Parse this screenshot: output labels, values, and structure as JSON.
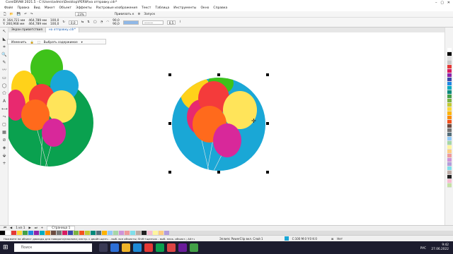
{
  "window": {
    "title": "CorelDRAW 2021.5 - C:\\Users\\admin\\Desktop\\PERW\\на отправку.cdr*"
  },
  "menu": [
    "Файл",
    "Правка",
    "Вид",
    "Макет",
    "Объект",
    "Эффекты",
    "Растровые изображения",
    "Текст",
    "Таблица",
    "Инструменты",
    "Окно",
    "Справка"
  ],
  "toolbar": {
    "zoom": "23%",
    "snap_label": "Привязать к",
    "launch_label": "Запуск"
  },
  "propertybar": {
    "x": "X: 164,721 мм",
    "y": "Y: 260,968 мм",
    "w": "464,789 мм",
    "h": "464,789 мм",
    "sx": "100,0",
    "sy": "100,0",
    "angle": "0,0",
    "outline": "0,5",
    "val1": "90,0",
    "val2": "90,0"
  },
  "tabs": [
    {
      "label": "Экран приветствия",
      "active": false
    },
    {
      "label": "на отправку.cdr*",
      "active": true
    }
  ],
  "floatbar": {
    "edit_label": "Изменить",
    "select_label": "Выбрать содержимое"
  },
  "pagenav": {
    "counter": "1 из 1",
    "page": "Страница 1"
  },
  "status": {
    "hint": "Нажмите на объект дважды для поворота/наклона; инстр. с двойн.щелч. - выб. все объекты; Shift+щелчок - выб. неск. объект.; Alt+щелчок - цифры; Ctrl+щелчок - выб. в группе",
    "object": "Эллипс PowerClip вкл. Слой 1",
    "color": "C:100 M:0 Y:0 K:0",
    "fill": "Нет"
  },
  "taskbar": {
    "search": "Поиск",
    "time": "9:42",
    "date": "27.06.2022",
    "lang": "РУС"
  },
  "colors": {
    "accent": "#1a5fb4",
    "green": "#0aa14f",
    "blue": "#1aa7d6"
  },
  "palette": [
    "#ffffff",
    "#000000",
    "#e0e0e0",
    "#c8c8c8",
    "#e53935",
    "#d81b60",
    "#8e24aa",
    "#3949ab",
    "#1e88e5",
    "#00acc1",
    "#00897b",
    "#43a047",
    "#7cb342",
    "#c0ca33",
    "#fdd835",
    "#ffb300",
    "#fb8c00",
    "#f4511e",
    "#6d4c41",
    "#757575",
    "#546e7a",
    "#90caf9",
    "#a5d6a7",
    "#fff59d",
    "#ffcc80",
    "#ef9a9a",
    "#ce93d8",
    "#b39ddb",
    "#80deea",
    "#bcaaa4",
    "#212121",
    "#f8bbd0",
    "#c5e1a5"
  ],
  "strip": [
    "#000000",
    "#ffffff",
    "#e53935",
    "#fdd835",
    "#43a047",
    "#1e88e5",
    "#8e24aa",
    "#00acc1",
    "#fb8c00",
    "#6d4c41",
    "#757575",
    "#d81b60",
    "#3949ab",
    "#7cb342",
    "#f4511e",
    "#c0ca33",
    "#00897b",
    "#546e7a",
    "#ffb300",
    "#90caf9",
    "#a5d6a7",
    "#ce93d8",
    "#ef9a9a",
    "#80deea",
    "#bcaaa4",
    "#212121",
    "#f8bbd0",
    "#fff59d",
    "#ffcc80",
    "#b39ddb"
  ]
}
